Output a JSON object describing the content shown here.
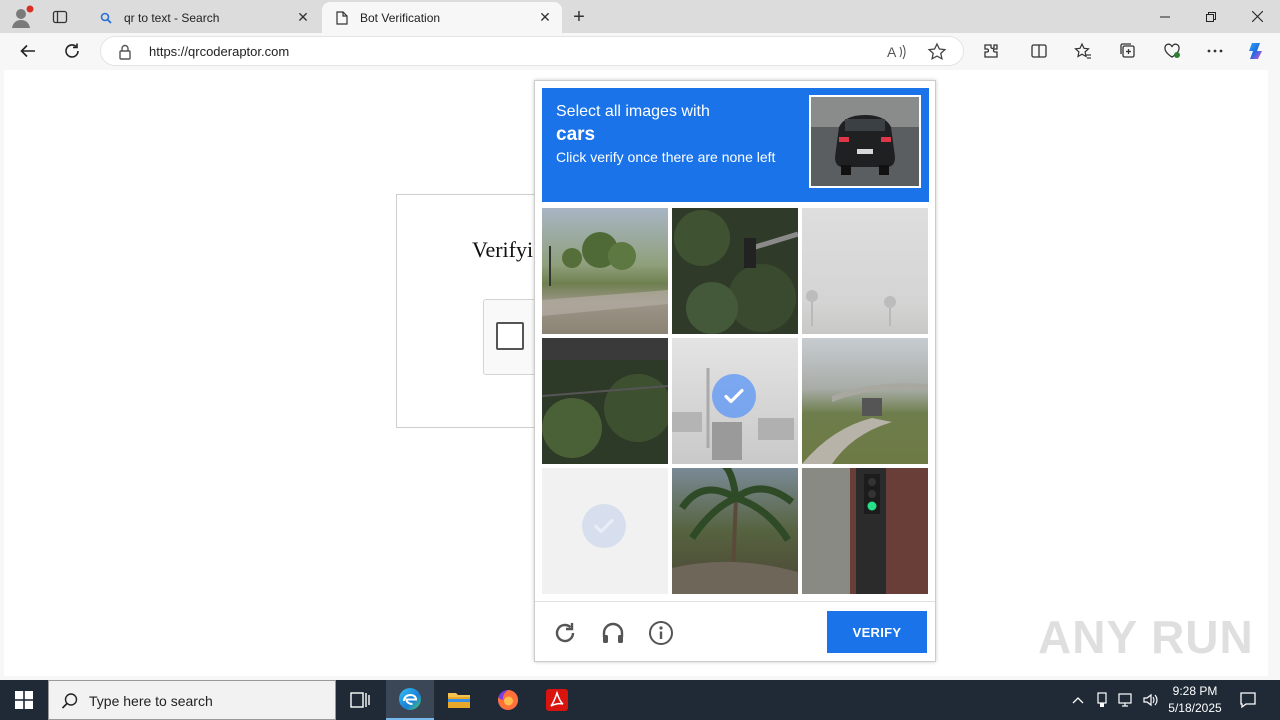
{
  "browser": {
    "tabs": [
      {
        "title": "qr to text - Search",
        "icon": "search-icon",
        "active": false
      },
      {
        "title": "Bot Verification",
        "icon": "page-icon",
        "active": true
      }
    ],
    "address": {
      "url": "https://qrcoderaptor.com"
    }
  },
  "page": {
    "heading_fragment": "Verifyi"
  },
  "captcha": {
    "prompt_line1": "Select all images with",
    "target": "cars",
    "instruction": "Click verify once there are none left",
    "tiles": [
      {
        "scene": "trees-grass-road",
        "selected": false
      },
      {
        "scene": "dense-foliage-traffic-light",
        "selected": false
      },
      {
        "scene": "faded-palm-horizon",
        "selected": false
      },
      {
        "scene": "dark-hedge",
        "selected": false
      },
      {
        "scene": "street-with-cars",
        "selected": true
      },
      {
        "scene": "overpass-road",
        "selected": false
      },
      {
        "scene": "faded-blank",
        "selected": true
      },
      {
        "scene": "palm-tree",
        "selected": false
      },
      {
        "scene": "traffic-light-brick-wall",
        "selected": false
      }
    ],
    "verify_label": "VERIFY",
    "footer_icons": [
      "reload-icon",
      "audio-headphones-icon",
      "info-icon"
    ],
    "accent_color": "#1a73e8"
  },
  "watermark": "ANY RUN",
  "taskbar": {
    "search_placeholder": "Type here to search",
    "time": "9:28 PM",
    "date": "5/18/2025"
  }
}
